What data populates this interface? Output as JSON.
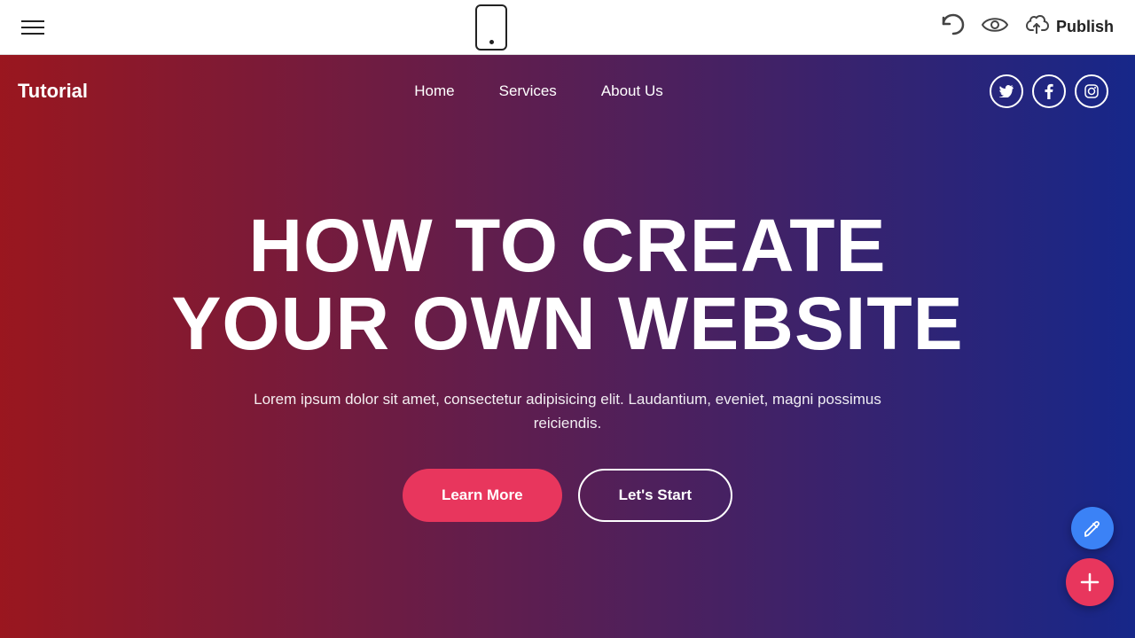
{
  "toolbar": {
    "publish_label": "Publish",
    "hamburger_name": "menu",
    "phone_preview_name": "mobile-preview"
  },
  "site": {
    "logo": "Tutorial",
    "nav": {
      "items": [
        {
          "label": "Home",
          "id": "home"
        },
        {
          "label": "Services",
          "id": "services"
        },
        {
          "label": "About Us",
          "id": "about"
        }
      ],
      "social": [
        {
          "label": "T",
          "name": "twitter",
          "icon": "𝕏"
        },
        {
          "label": "f",
          "name": "facebook",
          "icon": "f"
        },
        {
          "label": "ig",
          "name": "instagram",
          "icon": "◎"
        }
      ]
    },
    "hero": {
      "title_line1": "HOW TO CREATE",
      "title_line2": "YOUR OWN WEBSITE",
      "subtitle": "Lorem ipsum dolor sit amet, consectetur adipisicing elit. Laudantium, eveniet, magni possimus reiciendis.",
      "btn_learn_more": "Learn More",
      "btn_lets_start": "Let's Start"
    }
  },
  "fab": {
    "edit_icon": "✎",
    "add_icon": "+"
  }
}
